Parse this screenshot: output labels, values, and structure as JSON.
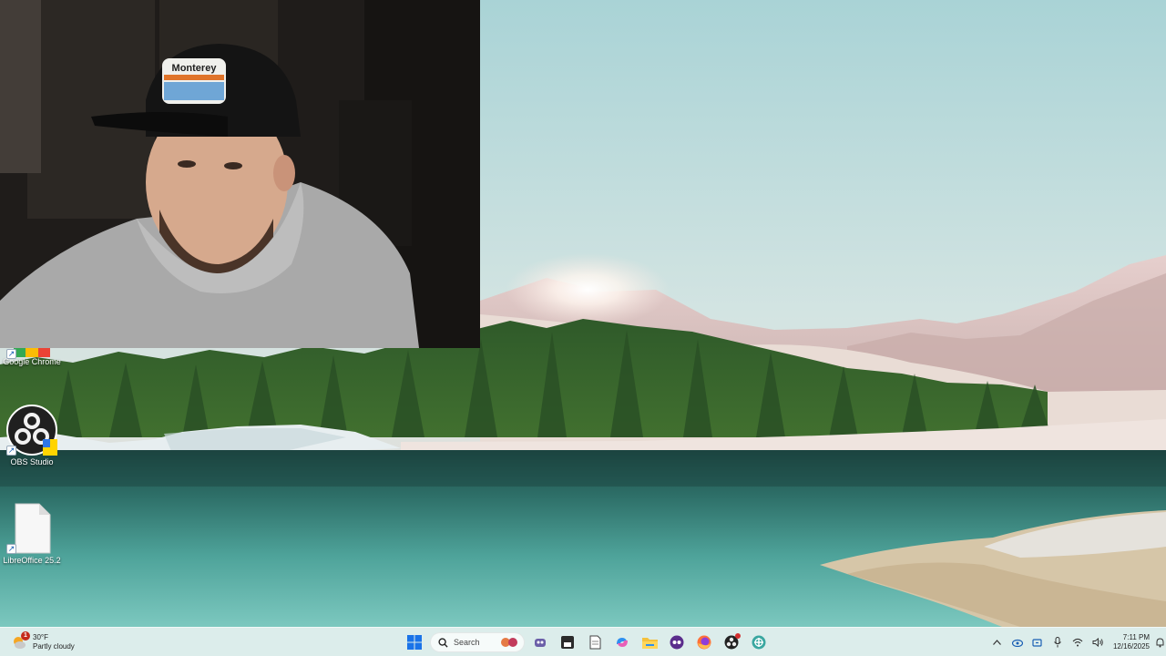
{
  "desktop": {
    "icons": [
      {
        "label": "Google Chrome",
        "icon": "chrome-icon"
      },
      {
        "label": "OBS Studio",
        "icon": "obs-icon"
      },
      {
        "label": "LibreOffice 25.2",
        "icon": "file-icon"
      }
    ]
  },
  "taskbar": {
    "weather": {
      "temp": "30°F",
      "condition": "Partly cloudy",
      "badge": "1"
    },
    "search_placeholder": "Search",
    "apps": [
      "windows-start-icon",
      "search-box",
      "paint-icon",
      "game-icon",
      "terminal-icon",
      "notepad-icon",
      "copilot-icon",
      "file-explorer-icon",
      "ai-app-icon",
      "firefox-icon",
      "obs-taskbar-icon",
      "network-app-icon"
    ],
    "clock": {
      "time": "7:11 PM",
      "date": "12/16/2025"
    }
  }
}
